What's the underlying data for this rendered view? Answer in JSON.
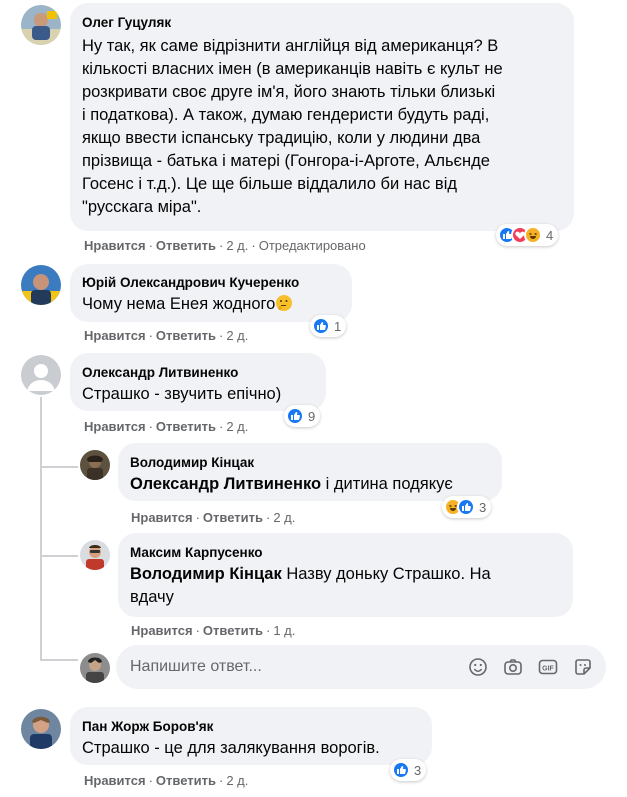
{
  "comments": [
    {
      "author": "Олег Гуцуляк",
      "lines": [
        "Ну так, як саме відрізнити англійця від американця? В",
        "кількості власних імен (в американців навіть є культ не",
        "розкривати своє друге ім'я, його знають тільки близькі",
        "і податкова). А також, думаю гендеристи будуть раді,",
        "якщо ввести іспанську традицію, коли у людини два",
        "прізвища - батька і матері (Гонгора-і-Арготе, Альєнде",
        "Госенс і т.д.). Це ще більше віддалило би нас від",
        "\"русскага міра\"."
      ],
      "like": "Нравится",
      "reply": "Ответить",
      "time": "2 д.",
      "edited": "Отредактировано",
      "reaction_count": "4",
      "reactions": [
        "like-icon",
        "love-icon",
        "haha-icon"
      ]
    },
    {
      "author": "Юрій Олександрович Кучеренко",
      "text": "Чому нема Енея жодного",
      "emoji": "thinking-face-icon",
      "like": "Нравится",
      "reply": "Ответить",
      "time": "2 д.",
      "reaction_count": "1",
      "reactions": [
        "like-icon"
      ]
    },
    {
      "author": "Олександр Литвиненко",
      "text": "Страшко - звучить епічно)",
      "like": "Нравится",
      "reply": "Ответить",
      "time": "2 д.",
      "reaction_count": "9",
      "reactions": [
        "like-icon"
      ]
    },
    {
      "author": "Володимир Кінцак",
      "mention": "Олександр Литвиненко",
      "text": "і дитина подякує",
      "like": "Нравится",
      "reply": "Ответить",
      "time": "2 д.",
      "reaction_count": "3",
      "reactions": [
        "haha-icon",
        "like-icon"
      ]
    },
    {
      "author": "Максим Карпусенко",
      "mention": "Володимир Кінцак",
      "text_line1": "Назву доньку Страшко. На",
      "text_line2": "вдачу",
      "like": "Нравится",
      "reply": "Ответить",
      "time": "1 д."
    },
    {
      "author": "Пан Жорж Боров'як",
      "text": "Страшко - це для залякування ворогів.",
      "like": "Нравится",
      "reply": "Ответить",
      "time": "2 д.",
      "reaction_count": "3",
      "reactions": [
        "like-icon"
      ]
    }
  ],
  "reply_box": {
    "placeholder": "Напишите ответ...",
    "icons": [
      "emoji-icon",
      "camera-icon",
      "gif-icon",
      "sticker-icon"
    ]
  },
  "colors": {
    "bubble": "#f0f2f5",
    "meta_text": "#65676b",
    "like_blue": "#1877f2",
    "love_red": "#f33e58",
    "haha_yellow": "#f7b125"
  }
}
